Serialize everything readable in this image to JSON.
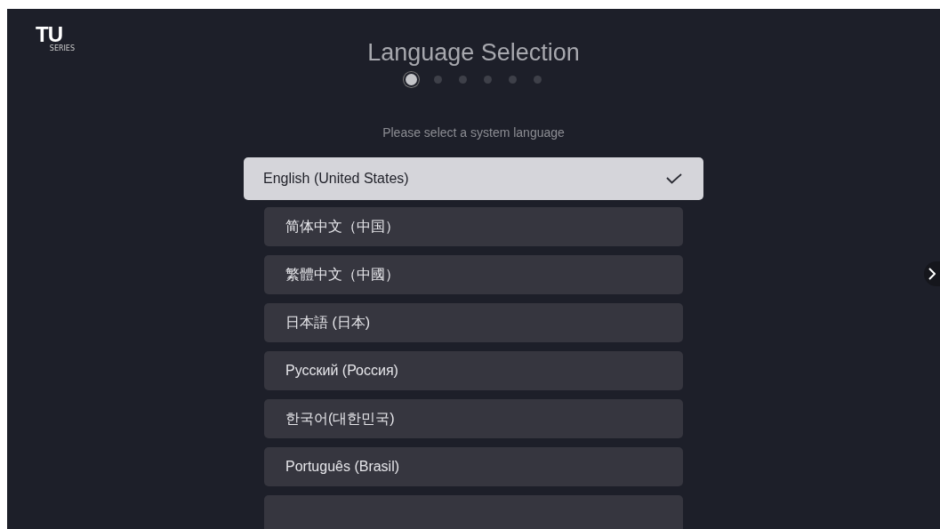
{
  "logo": {
    "text": "TU",
    "subtext": "SERIES"
  },
  "title": "Language Selection",
  "steps": [
    {
      "selected": true
    },
    {
      "selected": false
    },
    {
      "selected": false
    },
    {
      "selected": false
    },
    {
      "selected": false
    },
    {
      "selected": false
    }
  ],
  "subtitle": "Please select a system language",
  "languages": [
    {
      "label": "English (United States)",
      "selected": true
    },
    {
      "label": "简体中文（中国）",
      "selected": false
    },
    {
      "label": "繁體中文（中國）",
      "selected": false
    },
    {
      "label": "日本語 (日本)",
      "selected": false
    },
    {
      "label": "Русский (Россия)",
      "selected": false
    },
    {
      "label": "한국어(대한민국)",
      "selected": false
    },
    {
      "label": "Português (Brasil)",
      "selected": false
    }
  ]
}
